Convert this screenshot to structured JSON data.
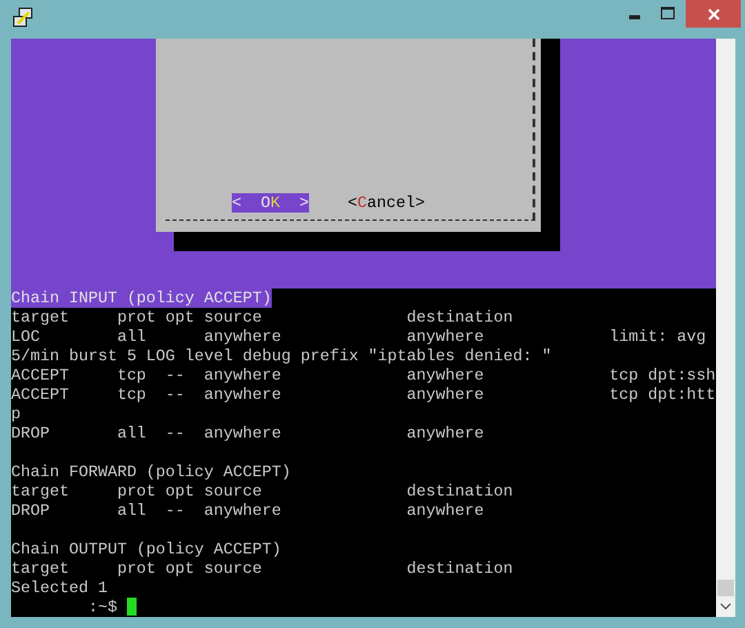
{
  "dialog": {
    "buttons": [
      {
        "before": "<  O",
        "hotkey": "K",
        "after": "  >",
        "selected": true
      },
      {
        "before": "<",
        "hotkey": "C",
        "after": "ancel>",
        "selected": false
      }
    ]
  },
  "terminal": {
    "lines": [
      {
        "kind": "highlight",
        "text": "Chain INPUT (policy ACCEPT)"
      },
      {
        "kind": "text",
        "text": "target     prot opt source               destination"
      },
      {
        "kind": "text",
        "text": "LOC        all      anywhere             anywhere             limit: avg"
      },
      {
        "kind": "text",
        "text": "5/min burst 5 LOG level debug prefix \"iptables denied: \""
      },
      {
        "kind": "text",
        "text": "ACCEPT     tcp  --  anywhere             anywhere             tcp dpt:ssh"
      },
      {
        "kind": "text",
        "text": "ACCEPT     tcp  --  anywhere             anywhere             tcp dpt:htt"
      },
      {
        "kind": "text",
        "text": "p"
      },
      {
        "kind": "text",
        "text": "DROP       all  --  anywhere             anywhere"
      },
      {
        "kind": "blank"
      },
      {
        "kind": "text",
        "text": "Chain FORWARD (policy ACCEPT)"
      },
      {
        "kind": "text",
        "text": "target     prot opt source               destination"
      },
      {
        "kind": "text",
        "text": "DROP       all  --  anywhere             anywhere"
      },
      {
        "kind": "blank"
      },
      {
        "kind": "text",
        "text": "Chain OUTPUT (policy ACCEPT)"
      },
      {
        "kind": "text",
        "text": "target     prot opt source               destination"
      },
      {
        "kind": "text",
        "text": "Selected 1"
      },
      {
        "kind": "prompt",
        "text": ":~$"
      }
    ]
  }
}
